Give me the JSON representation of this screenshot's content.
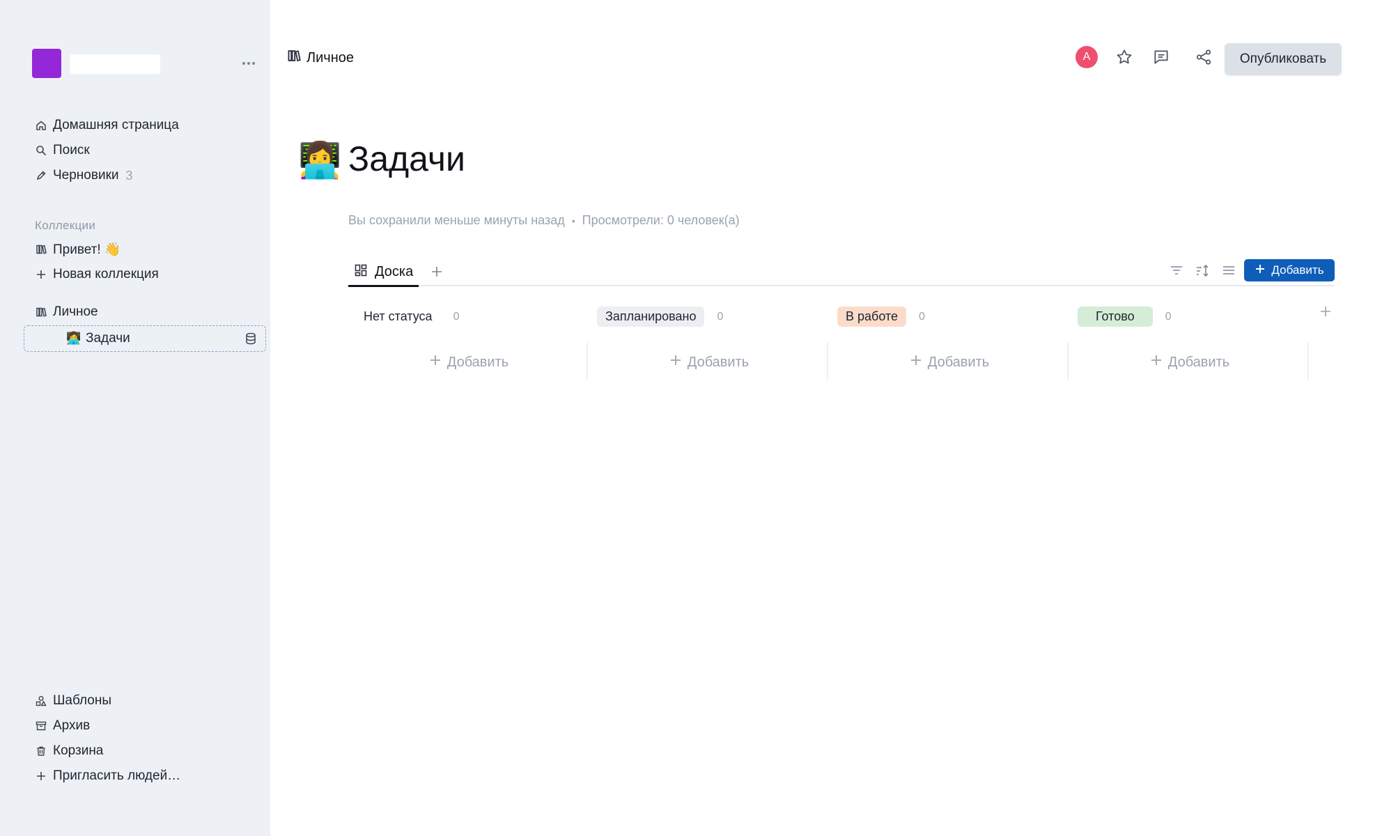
{
  "sidebar": {
    "nav": [
      {
        "label": "Домашняя страница",
        "icon": "home-icon"
      },
      {
        "label": "Поиск",
        "icon": "search-icon"
      },
      {
        "label": "Черновики",
        "icon": "pencil-icon",
        "count": "3"
      }
    ],
    "collections_label": "Коллекции",
    "collections": [
      {
        "label": "Привет! 👋",
        "icon": "books-icon"
      },
      {
        "label": "Новая коллекция",
        "icon": "plus-icon"
      }
    ],
    "personal": {
      "label": "Личное",
      "icon": "books-icon"
    },
    "active_doc": {
      "emoji": "👩‍💻",
      "label": "Задачи"
    },
    "bottom": [
      {
        "label": "Шаблоны",
        "icon": "shapes-icon"
      },
      {
        "label": "Архив",
        "icon": "archive-icon"
      },
      {
        "label": "Корзина",
        "icon": "trash-icon"
      },
      {
        "label": "Пригласить людей…",
        "icon": "plus-icon"
      }
    ],
    "team_color": "#9427d8"
  },
  "header": {
    "breadcrumb": "Личное",
    "avatar_letter": "A",
    "avatar_color": "#f04e6e",
    "publish_label": "Опубликовать"
  },
  "page": {
    "emoji": "👩‍💻",
    "title": "Задачи",
    "saved": "Вы сохранили меньше минуты назад",
    "dot": "•",
    "viewed": "Просмотрели: 0 человек(а)"
  },
  "board": {
    "tab_label": "Доска",
    "add_label": "Добавить",
    "accent": "#0e5eb9",
    "columns": [
      {
        "status": "Нет статуса",
        "count": "0"
      },
      {
        "status": "Запланировано",
        "count": "0"
      },
      {
        "status": "В работе",
        "count": "0"
      },
      {
        "status": "Готово",
        "count": "0"
      }
    ],
    "column_add_label": "Добавить"
  }
}
